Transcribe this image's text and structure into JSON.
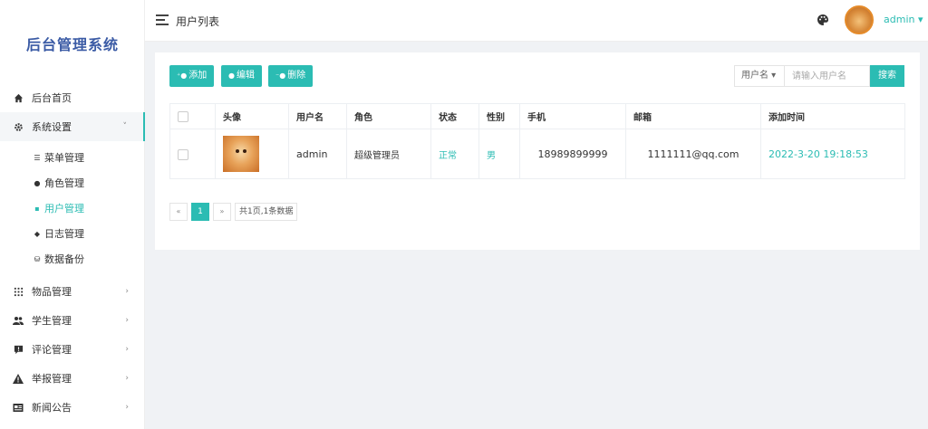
{
  "app": {
    "brand": "后台管理系统"
  },
  "header": {
    "title": "用户列表",
    "user_name": "admin ▾"
  },
  "sidebar": {
    "items": [
      {
        "label": "后台首页",
        "icon": "home-icon"
      },
      {
        "label": "系统设置",
        "icon": "gear-icon",
        "arrow": "˅"
      },
      {
        "label": "物品管理",
        "icon": "grid-icon",
        "arrow": "›"
      },
      {
        "label": "学生管理",
        "icon": "users-icon",
        "arrow": "›"
      },
      {
        "label": "评论管理",
        "icon": "comment-icon",
        "arrow": "›"
      },
      {
        "label": "举报管理",
        "icon": "warning-icon",
        "arrow": "›"
      },
      {
        "label": "新闻公告",
        "icon": "news-icon",
        "arrow": "›"
      }
    ],
    "sub_items": [
      {
        "label": "菜单管理",
        "icon": "list-icon"
      },
      {
        "label": "角色管理",
        "icon": "role-icon"
      },
      {
        "label": "用户管理",
        "icon": "user-icon"
      },
      {
        "label": "日志管理",
        "icon": "tag-icon"
      },
      {
        "label": "数据备份",
        "icon": "database-icon"
      }
    ]
  },
  "toolbar": {
    "add_label": "添加",
    "edit_label": "编辑",
    "delete_label": "删除"
  },
  "search": {
    "field_select": "用户名 ▾",
    "placeholder": "请输入用户名",
    "button_label": "搜索"
  },
  "table": {
    "columns": [
      "",
      "头像",
      "用户名",
      "角色",
      "状态",
      "性别",
      "手机",
      "邮箱",
      "添加时间"
    ],
    "rows": [
      {
        "username": "admin",
        "role": "超级管理员",
        "status": "正常",
        "gender": "男",
        "phone": "18989899999",
        "email": "1111111@qq.com",
        "added": "2022-3-20 19:18:53"
      }
    ]
  },
  "pagination": {
    "prev": "«",
    "current": "1",
    "next": "»",
    "info": "共1页,1条数据"
  },
  "colors": {
    "accent": "#2bbcb3",
    "brand": "#3b5ba5"
  }
}
